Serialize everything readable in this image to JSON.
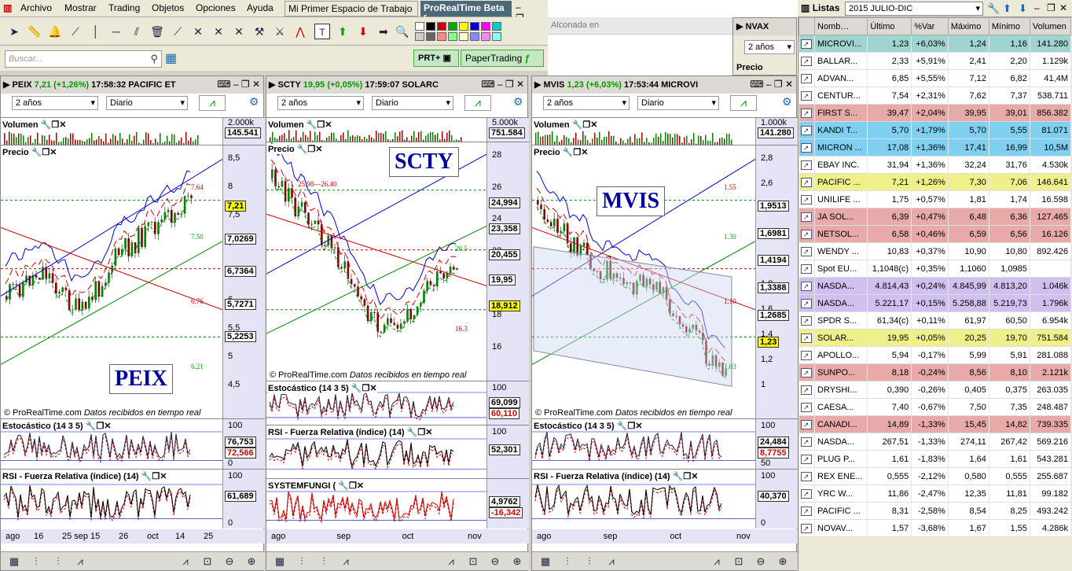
{
  "menu": {
    "items": [
      "Archivo",
      "Mostrar",
      "Trading",
      "Objetos",
      "Opciones",
      "Ayuda"
    ],
    "workspace_tab": "Mi Primer Espacio de Trabajo",
    "prt_tab": "ProRealTime Beta [",
    "win_controls": "– ❐ ✕"
  },
  "toolbar": {
    "search_placeholder": "Buscar...",
    "prt_plus_label": "PRT+",
    "paper_trading_label": "PaperTrading"
  },
  "background": {
    "tab_label": "Alconada en",
    "nvax_label": "NVAX",
    "nvax_period": "2 años",
    "nvax_precio": "Precio"
  },
  "colors": {
    "accent_green": "#c4e8c4",
    "candle_up": "#008000",
    "candle_down": "#800000",
    "axis_bg": "#e4e4f6"
  },
  "charts": [
    {
      "id": "peix",
      "symbol": "PEIX",
      "price": "7,21",
      "change": "(+1,26%)",
      "time": "17:58:32",
      "name": "PACIFIC ET",
      "period": "2 años",
      "interval": "Diario",
      "volumen_label": "Volumen",
      "vol_max": "2.000k",
      "vol_last": "145.541",
      "precio_label": "Precio",
      "yticks": [
        "8,5",
        "8",
        "7,5",
        "7",
        "6,5",
        "6",
        "5,5",
        "5",
        "4,5"
      ],
      "price_boxes": [
        "7,21",
        "7,0269",
        "6,7364",
        "5,7271",
        "5,2253"
      ],
      "levels": [
        "7.64",
        "7.50",
        "6.76",
        "6.21"
      ],
      "big_label": "PEIX",
      "watermark_brand": "© ProRealTime.com",
      "watermark_note": "Datos recibidos en tiempo real",
      "stoch_label": "Estocástico (14 3 5)",
      "stoch_v1": "76,753",
      "stoch_v2": "72,566",
      "stoch_top": "100",
      "stoch_bot": "0",
      "rsi_label": "RSI - Fuerza Relativa (índice) (14)",
      "rsi_v": "61,689",
      "rsi_top": "100",
      "rsi_bot": "0",
      "xlabels": [
        "ago",
        "16",
        "25 sep",
        "15",
        "26",
        "oct",
        "14",
        "25"
      ]
    },
    {
      "id": "scty",
      "symbol": "SCTY",
      "price": "19,95",
      "change": "(+0,05%)",
      "time": "17:59:07",
      "name": "SOLARC",
      "period": "2 años",
      "interval": "Diario",
      "volumen_label": "Volumen",
      "vol_max": "5.000k",
      "vol_last": "751.584",
      "precio_label": "Precio",
      "yticks": [
        "28",
        "26",
        "24",
        "22",
        "20",
        "18",
        "16"
      ],
      "price_boxes": [
        "24,994",
        "23,358",
        "20,455",
        "19,95",
        "18,912"
      ],
      "levels": [
        "25.98---26.40",
        "20.5",
        "16.3"
      ],
      "big_label": "SCTY",
      "watermark_brand": "© ProRealTime.com",
      "watermark_note": "Datos recibidos en tiempo real",
      "stoch_label": "Estocástico (14 3 5)",
      "stoch_v1": "69,099",
      "stoch_v2": "60,110",
      "stoch_top": "100",
      "stoch_bot": "",
      "rsi_label": "RSI - Fuerza Relativa (índice) (14)",
      "rsi_v": "52,301",
      "rsi_top": "100",
      "rsi_bot": "",
      "sys_label": "SYSTEMFUNGI (",
      "sys_v1": "4,9762",
      "sys_v2": "-16,342",
      "xlabels": [
        "ago",
        "sep",
        "oct",
        "nov"
      ]
    },
    {
      "id": "mvis",
      "symbol": "MVIS",
      "price": "1,23 (+6,03%)",
      "change": "",
      "time": "17:53:44",
      "name": "MICROVI",
      "period": "2 años",
      "interval": "Diario",
      "volumen_label": "Volumen",
      "vol_max": "1.000k",
      "vol_last": "141.280",
      "precio_label": "Precio",
      "yticks": [
        "2,8",
        "2,6",
        "2,4",
        "2,2",
        "2",
        "1,8",
        "1,6",
        "1,4",
        "1,2",
        "1"
      ],
      "price_boxes": [
        "1,9513",
        "1,6981",
        "1,4194",
        "1,3388",
        "1,2685",
        "1,23"
      ],
      "levels": [
        "1.55",
        "1.30",
        "1.10",
        "1.03"
      ],
      "big_label": "MVIS",
      "watermark_brand": "© ProRealTime.com",
      "watermark_note": "Datos recibidos en tiempo real",
      "stoch_label": "Estocástico (14 3 5)",
      "stoch_v1": "24,484",
      "stoch_v2": "8,7755",
      "stoch_top": "100",
      "stoch_bot": "50",
      "rsi_label": "RSI - Fuerza Relativa (índice) (14)",
      "rsi_v": "40,370",
      "rsi_top": "100",
      "rsi_bot": "0",
      "xlabels": [
        "ago",
        "sep",
        "oct",
        "nov"
      ]
    }
  ],
  "lists": {
    "title": "Listas",
    "selected": "2015 JULIO-DIC",
    "columns": [
      "Nomb…",
      "Último",
      "%Var",
      "Máximo",
      "Mínimo",
      "Volumen"
    ],
    "rows": [
      {
        "name": "MICROVI...",
        "last": "1,23",
        "var": "+6,03%",
        "max": "1,24",
        "min": "1,16",
        "vol": "141.280",
        "bg": "#9fd4cf"
      },
      {
        "name": "BALLAR...",
        "last": "2,33",
        "var": "+5,91%",
        "max": "2,41",
        "min": "2,20",
        "vol": "1.129k",
        "bg": "#ffffff"
      },
      {
        "name": "ADVAN...",
        "last": "6,85",
        "var": "+5,55%",
        "max": "7,12",
        "min": "6,82",
        "vol": "41,4M",
        "bg": "#ffffff"
      },
      {
        "name": "CENTUR...",
        "last": "7,54",
        "var": "+2,31%",
        "max": "7,62",
        "min": "7,37",
        "vol": "538.711",
        "bg": "#ffffff"
      },
      {
        "name": "FIRST S...",
        "last": "39,47",
        "var": "+2,04%",
        "max": "39,95",
        "min": "39,01",
        "vol": "856.382",
        "bg": "#e8a9a9"
      },
      {
        "name": "KANDI T...",
        "last": "5,70",
        "var": "+1,79%",
        "max": "5,70",
        "min": "5,55",
        "vol": "81.071",
        "bg": "#7fd0f0"
      },
      {
        "name": "MICRON ...",
        "last": "17,08",
        "var": "+1,36%",
        "max": "17,41",
        "min": "16,99",
        "vol": "10,5M",
        "bg": "#7fd0f0"
      },
      {
        "name": "EBAY INC.",
        "last": "31,94",
        "var": "+1,36%",
        "max": "32,24",
        "min": "31,76",
        "vol": "4.530k",
        "bg": "#ffffff"
      },
      {
        "name": "PACIFIC ...",
        "last": "7,21",
        "var": "+1,26%",
        "max": "7,30",
        "min": "7,06",
        "vol": "146.641",
        "bg": "#f0f08a"
      },
      {
        "name": "UNILIFE ...",
        "last": "1,75",
        "var": "+0,57%",
        "max": "1,81",
        "min": "1,74",
        "vol": "16.598",
        "bg": "#ffffff"
      },
      {
        "name": "JA SOL...",
        "last": "6,39",
        "var": "+0,47%",
        "max": "6,48",
        "min": "6,36",
        "vol": "127.465",
        "bg": "#e8a9a9"
      },
      {
        "name": "NETSOL...",
        "last": "6,58",
        "var": "+0,46%",
        "max": "6,59",
        "min": "6,56",
        "vol": "16.126",
        "bg": "#e8a9a9"
      },
      {
        "name": "WENDY ...",
        "last": "10,83",
        "var": "+0,37%",
        "max": "10,90",
        "min": "10,80",
        "vol": "892.426",
        "bg": "#ffffff"
      },
      {
        "name": "Spot EU...",
        "last": "1,1048(c)",
        "var": "+0,35%",
        "max": "1,1060",
        "min": "1,0985",
        "vol": "",
        "bg": "#ffffff"
      },
      {
        "name": "NASDA...",
        "last": "4.814,43",
        "var": "+0,24%",
        "max": "4.845,99",
        "min": "4.813,20",
        "vol": "1.046k",
        "bg": "#d0c0f0"
      },
      {
        "name": "NASDA...",
        "last": "5.221,17",
        "var": "+0,15%",
        "max": "5.258,88",
        "min": "5.219,73",
        "vol": "1.796k",
        "bg": "#d0c0f0"
      },
      {
        "name": "SPDR S...",
        "last": "61,34(c)",
        "var": "+0,11%",
        "max": "61,97",
        "min": "60,50",
        "vol": "6.954k",
        "bg": "#ffffff"
      },
      {
        "name": "SOLAR...",
        "last": "19,95",
        "var": "+0,05%",
        "max": "20,25",
        "min": "19,70",
        "vol": "751.584",
        "bg": "#f0f08a"
      },
      {
        "name": "APOLLO...",
        "last": "5,94",
        "var": "-0,17%",
        "max": "5,99",
        "min": "5,91",
        "vol": "281.088",
        "bg": "#ffffff"
      },
      {
        "name": "SUNPO...",
        "last": "8,18",
        "var": "-0,24%",
        "max": "8,56",
        "min": "8,10",
        "vol": "2.121k",
        "bg": "#e8a9a9"
      },
      {
        "name": "DRYSHI...",
        "last": "0,390",
        "var": "-0,26%",
        "max": "0,405",
        "min": "0,375",
        "vol": "263.035",
        "bg": "#ffffff"
      },
      {
        "name": "CAESA...",
        "last": "7,40",
        "var": "-0,67%",
        "max": "7,50",
        "min": "7,35",
        "vol": "248.487",
        "bg": "#ffffff"
      },
      {
        "name": "CANADI...",
        "last": "14,89",
        "var": "-1,33%",
        "max": "15,45",
        "min": "14,82",
        "vol": "739.335",
        "bg": "#e8a9a9"
      },
      {
        "name": "NASDA...",
        "last": "267,51",
        "var": "-1,33%",
        "max": "274,11",
        "min": "267,42",
        "vol": "569.216",
        "bg": "#ffffff"
      },
      {
        "name": "PLUG P...",
        "last": "1,61",
        "var": "-1,83%",
        "max": "1,64",
        "min": "1,61",
        "vol": "543.281",
        "bg": "#ffffff"
      },
      {
        "name": "REX ENE...",
        "last": "0,555",
        "var": "-2,12%",
        "max": "0,580",
        "min": "0,555",
        "vol": "255.687",
        "bg": "#ffffff"
      },
      {
        "name": "YRC W...",
        "last": "11,86",
        "var": "-2,47%",
        "max": "12,35",
        "min": "11,81",
        "vol": "99.182",
        "bg": "#ffffff"
      },
      {
        "name": "PACIFIC ...",
        "last": "8,31",
        "var": "-2,58%",
        "max": "8,54",
        "min": "8,25",
        "vol": "493.242",
        "bg": "#ffffff"
      },
      {
        "name": "NOVAV...",
        "last": "1,57",
        "var": "-3,68%",
        "max": "1,67",
        "min": "1,55",
        "vol": "4.286k",
        "bg": "#ffffff"
      }
    ]
  }
}
